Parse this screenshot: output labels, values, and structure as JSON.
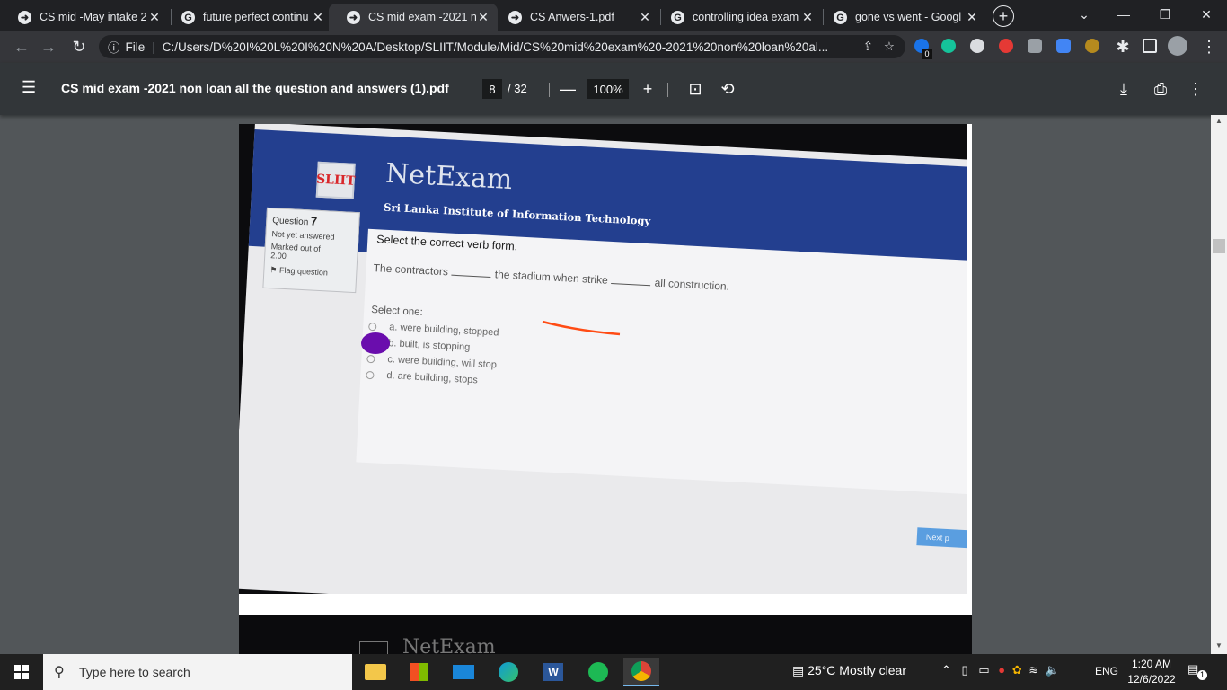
{
  "tabs": [
    {
      "label": "CS mid -May intake 20",
      "icon": "extension-icon"
    },
    {
      "label": "future perfect continu",
      "icon": "google-icon"
    },
    {
      "label": "CS mid exam -2021 n",
      "icon": "extension-icon"
    },
    {
      "label": "CS Anwers-1.pdf",
      "icon": "extension-icon"
    },
    {
      "label": "controlling idea exam",
      "icon": "google-icon"
    },
    {
      "label": "gone vs went - Googl",
      "icon": "google-icon"
    }
  ],
  "address": {
    "prefix": "File",
    "url": "C:/Users/D%20I%20L%20I%20N%20A/Desktop/SLIIT/Module/Mid/CS%20mid%20exam%20-2021%20non%20loan%20al..."
  },
  "extension_badge": "0",
  "pdf": {
    "title": "CS mid exam -2021 non loan all the question and answers (1).pdf",
    "page_current": "8",
    "page_total": "/ 32",
    "zoom": "100%"
  },
  "exam": {
    "logo": "SLIIT",
    "brand": "NetExam",
    "institute": "Sri Lanka Institute of Information Technology",
    "question_label": "Question",
    "question_number": "7",
    "status": "Not yet answered",
    "marked": "Marked out of",
    "marks": "2.00",
    "flag": "Flag question",
    "prompt": "Select the correct verb form.",
    "sentence_start": "The contractors",
    "sentence_mid": "the stadium when strike",
    "sentence_end": "all construction.",
    "select_one": "Select one:",
    "options": [
      "a. were building, stopped",
      "b. built, is stopping",
      "c. were building, will stop",
      "d. are building, stops"
    ],
    "next": "Next p",
    "page2_brand": "NetExam"
  },
  "taskbar": {
    "search_placeholder": "Type here to search",
    "weather": "25°C  Mostly clear",
    "lang": "ENG",
    "time": "1:20 AM",
    "date": "12/6/2022",
    "notif_count": "1"
  }
}
